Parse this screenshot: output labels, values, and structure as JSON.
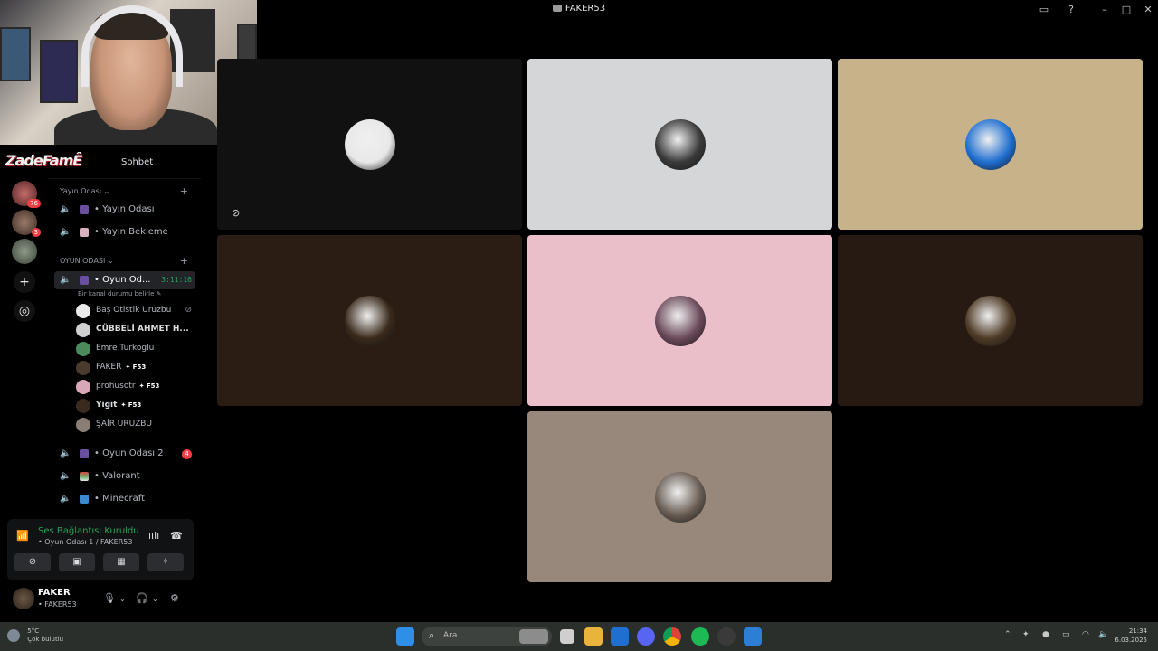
{
  "window": {
    "title": "FAKER53"
  },
  "server_header": {
    "label": "Sohbet",
    "logo_text": "ZadeFamÊ"
  },
  "servers": [
    {
      "badge": "76"
    },
    {
      "badge": "3"
    },
    {
      "badge": ""
    }
  ],
  "categories": [
    {
      "label": "Yayın Odası ⌄"
    },
    {
      "label": "OYUN ODASI ⌄"
    }
  ],
  "channels": [
    {
      "label": "• Yayın Odası"
    },
    {
      "label": "• Yayın Bekleme"
    },
    {
      "label": "• Oyun Od...",
      "timer": "3:11:16",
      "status": "Bir kanal durumu belirle ✎"
    },
    {
      "label": "• Oyun Odası 2",
      "badge": "4"
    },
    {
      "label": "• Valorant"
    },
    {
      "label": "• Minecraft"
    }
  ],
  "voice_users": [
    {
      "name": "Baş Otistik Uruzbu",
      "tag": ""
    },
    {
      "name": "CÜBBELİ AHMET H...",
      "tag": ""
    },
    {
      "name": "Emre Türkoğlu",
      "tag": ""
    },
    {
      "name": "FAKER",
      "tag": "✦ F53"
    },
    {
      "name": "prohusotr",
      "tag": "✦ F53"
    },
    {
      "name": "Yiğit",
      "tag": "✦ F53"
    },
    {
      "name": "ŞAİR URUZBU",
      "tag": ""
    }
  ],
  "voice_panel": {
    "title": "Ses Bağlantısı Kuruldu",
    "subtitle": "• Oyun Odası 1 / FAKER53"
  },
  "user_panel": {
    "name": "FAKER",
    "subtitle": "• FAKER53"
  },
  "tiles": [
    {
      "bg": "#111111",
      "avatar": "#e8e8e8"
    },
    {
      "bg": "#d5d6d8",
      "avatar": "#3a3a3a"
    },
    {
      "bg": "#c8b289",
      "avatar": "#1f6fd0"
    },
    {
      "bg": "#2b1c14",
      "avatar": "#3a2a1c"
    },
    {
      "bg": "#ebbfca",
      "avatar": "#6b4a5a"
    },
    {
      "bg": "#261a12",
      "avatar": "#4e3a26"
    },
    {
      "bg": "#97887b",
      "avatar": "#6a5e55"
    }
  ],
  "taskbar": {
    "weather_temp": "5°C",
    "weather_desc": "Çok bulutlu",
    "search_placeholder": "Ara",
    "time": "21:34",
    "date": "6.03.2025"
  }
}
